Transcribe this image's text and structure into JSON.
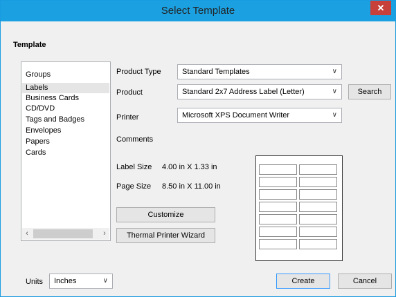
{
  "window": {
    "title": "Select Template",
    "close_glyph": "✕"
  },
  "template_section": {
    "label": "Template"
  },
  "groups": {
    "header": "Groups",
    "items": [
      "Labels",
      "Business Cards",
      "CD/DVD",
      "Tags and Badges",
      "Envelopes",
      "Papers",
      "Cards"
    ],
    "selected": "Labels"
  },
  "fields": {
    "product_type": {
      "label": "Product Type",
      "value": "Standard Templates"
    },
    "product": {
      "label": "Product",
      "value": "Standard 2x7 Address Label (Letter)"
    },
    "printer": {
      "label": "Printer",
      "value": "Microsoft XPS Document Writer"
    },
    "comments": {
      "label": "Comments"
    },
    "label_size": {
      "label": "Label Size",
      "value": "4.00 in X 1.33 in"
    },
    "page_size": {
      "label": "Page Size",
      "value": "8.50 in X 11.00 in"
    }
  },
  "buttons": {
    "search": "Search",
    "customize": "Customize",
    "thermal": "Thermal Printer Wizard",
    "create": "Create",
    "cancel": "Cancel"
  },
  "units": {
    "label": "Units",
    "value": "Inches"
  },
  "preview": {
    "columns": 2,
    "rows": 7
  },
  "icons": {
    "dropdown": "chevron-down-icon",
    "scroll_left": "arrow-left-icon",
    "scroll_right": "arrow-right-icon"
  },
  "colors": {
    "title_bar": "#1ba1e2",
    "close_button": "#c7403a",
    "selection": "#e5e5e5"
  }
}
